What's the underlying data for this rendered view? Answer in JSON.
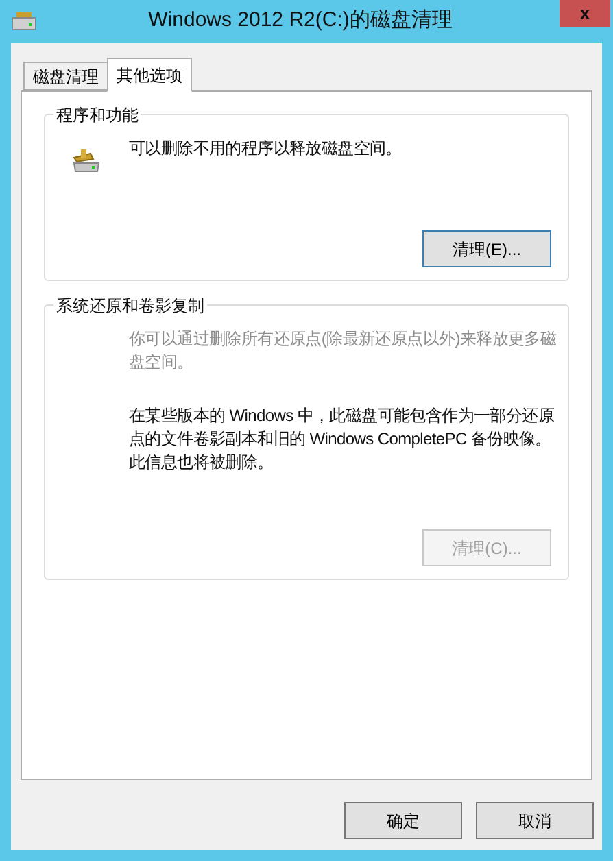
{
  "window": {
    "title": "Windows 2012 R2(C:)的磁盘清理",
    "close": "x"
  },
  "tabs": [
    {
      "label": "磁盘清理",
      "selected": false
    },
    {
      "label": "其他选项",
      "selected": true
    }
  ],
  "groups": [
    {
      "title": "程序和功能",
      "icon": true,
      "paragraphs": [
        {
          "text": "可以删除不用的程序以释放磁盘空间。",
          "disabled": false
        }
      ],
      "button": {
        "label": "清理(E)...",
        "disabled": false,
        "focused": true
      }
    },
    {
      "title": "系统还原和卷影复制",
      "icon": false,
      "paragraphs": [
        {
          "text": "你可以通过删除所有还原点(除最新还原点以外)来释放更多磁盘空间。",
          "disabled": true
        },
        {
          "text": "在某些版本的 Windows 中，此磁盘可能包含作为一部分还原点的文件卷影副本和旧的 Windows CompletePC 备份映像。此信息也将被删除。",
          "disabled": false
        }
      ],
      "button": {
        "label": "清理(C)...",
        "disabled": true,
        "focused": false
      }
    }
  ],
  "buttons": [
    {
      "label": "确定"
    },
    {
      "label": "取消"
    }
  ]
}
